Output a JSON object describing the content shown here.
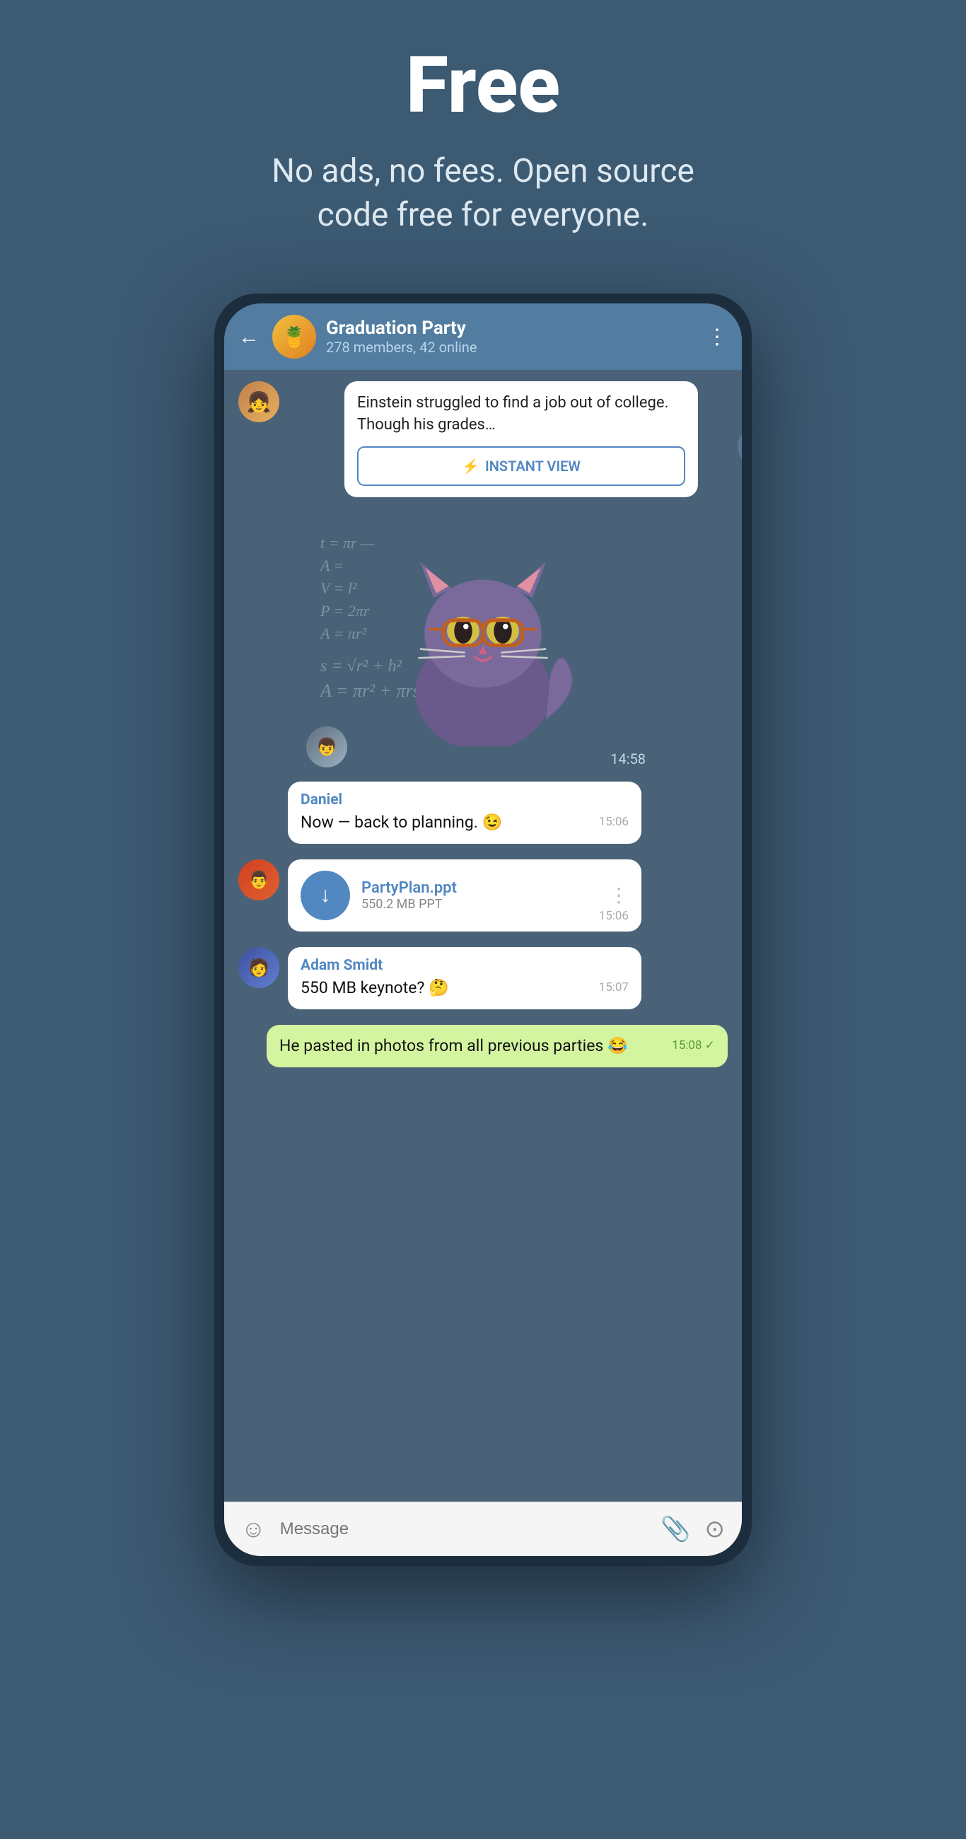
{
  "hero": {
    "title": "Free",
    "subtitle": "No ads, no fees. Open source code free for everyone."
  },
  "header": {
    "back_label": "←",
    "group_name": "Graduation Party",
    "group_info": "278 members, 42 online",
    "more_icon": "⋮",
    "avatar_emoji": "🍍"
  },
  "instant_view": {
    "text": "Einstein struggled to find a job out of college. Though his grades…",
    "button_label": "INSTANT VIEW",
    "lightning": "⚡"
  },
  "sticker": {
    "time": "14:58"
  },
  "messages": [
    {
      "sender": "Daniel",
      "text": "Now — back to planning. 😉",
      "time": "15:06",
      "type": "received"
    },
    {
      "sender": null,
      "file_name": "PartyPlan.ppt",
      "file_size": "550.2 MB PPT",
      "time": "15:06",
      "type": "file"
    },
    {
      "sender": "Adam Smidt",
      "text": "550 MB keynote? 🤔",
      "time": "15:07",
      "type": "received"
    },
    {
      "sender": null,
      "text": "He pasted in photos from all previous parties 😂",
      "time": "15:08",
      "type": "sent",
      "checkmark": "✓"
    }
  ],
  "input_bar": {
    "placeholder": "Message",
    "emoji_icon": "☺",
    "attach_icon": "📎",
    "camera_icon": "⊙"
  }
}
